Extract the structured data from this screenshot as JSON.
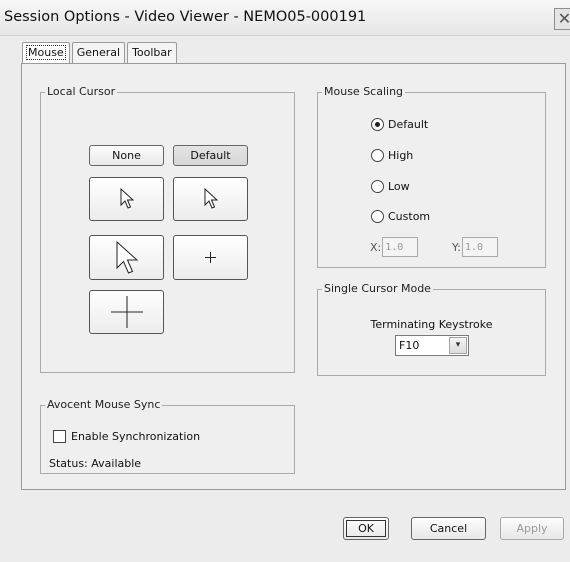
{
  "window": {
    "title": "Session Options - Video Viewer - NEMO05-000191",
    "close_glyph": "✕"
  },
  "tabs": [
    "Mouse",
    "General",
    "Toolbar"
  ],
  "local_cursor": {
    "legend": "Local Cursor",
    "none_label": "None",
    "default_label": "Default",
    "cursors": [
      "small-arrow",
      "small-arrow",
      "large-arrow",
      "small-crosshair",
      "large-crosshair"
    ],
    "selected": "Default"
  },
  "mouse_scaling": {
    "legend": "Mouse Scaling",
    "options": [
      "Default",
      "High",
      "Low",
      "Custom"
    ],
    "selected": "Default",
    "x_label": "X:",
    "x_value": "1.0",
    "y_label": "Y:",
    "y_value": "1.0"
  },
  "single_cursor_mode": {
    "legend": "Single Cursor Mode",
    "keystroke_label": "Terminating Keystroke",
    "keystroke_value": "F10",
    "dropdown_glyph": "▾"
  },
  "mouse_sync": {
    "legend": "Avocent Mouse Sync",
    "enable_label": "Enable Synchronization",
    "enabled": false,
    "status_label": "Status:",
    "status_value": "Available"
  },
  "footer": {
    "ok_label": "OK",
    "cancel_label": "Cancel",
    "apply_label": "Apply"
  },
  "colors": {
    "window_bg": "#ececec",
    "border": "#9a9a9a",
    "disabled_text": "#999999"
  }
}
